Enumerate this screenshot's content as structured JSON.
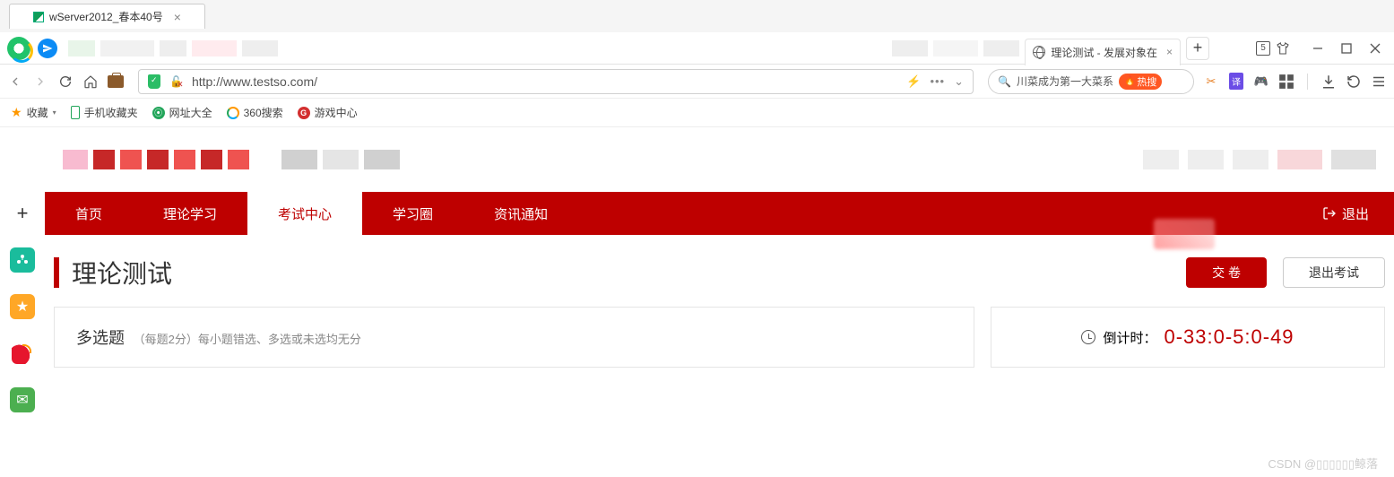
{
  "sys_tab": {
    "title": "wServer2012_春本40号"
  },
  "browser_tab": {
    "title": "理论测试 - 发展对象在"
  },
  "tab_count": "5",
  "address_bar": {
    "url": "http://www.testso.com/"
  },
  "search_suggest": {
    "text": "川菜成为第一大菜系",
    "hot_label": "热搜"
  },
  "bookmarks": {
    "fav": "收藏",
    "mobile": "手机收藏夹",
    "wzdq": "网址大全",
    "so360": "360搜索",
    "game": "游戏中心"
  },
  "nav": {
    "items": [
      "首页",
      "理论学习",
      "考试中心",
      "学习圈",
      "资讯通知"
    ],
    "active_index": 2,
    "logout": "退出"
  },
  "page_title": "理论测试",
  "buttons": {
    "submit": "交 卷",
    "exit": "退出考试"
  },
  "question": {
    "type": "多选题",
    "note": "（每题2分）每小题错选、多选或未选均无分"
  },
  "timer": {
    "label": "倒计时：",
    "value": "0-33:0-5:0-49"
  },
  "watermark": "CSDN @▯▯▯▯▯▯鲸落"
}
